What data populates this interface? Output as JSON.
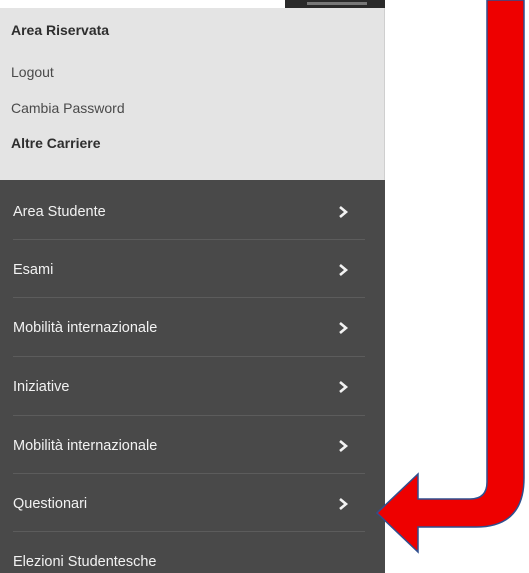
{
  "reserved_area": {
    "title": "Area Riservata",
    "logout": "Logout",
    "change_password": "Cambia Password",
    "other_careers": "Altre Carriere"
  },
  "menu": {
    "items": [
      {
        "label": "Area Studente"
      },
      {
        "label": "Esami"
      },
      {
        "label": "Mobilità internazionale"
      },
      {
        "label": "Iniziative"
      },
      {
        "label": "Mobilità internazionale"
      },
      {
        "label": "Questionari"
      },
      {
        "label": "Elezioni Studentesche"
      }
    ]
  },
  "colors": {
    "menu_background": "#494949",
    "reserved_area_background": "#e4e4e4",
    "arrow_fill": "#ee0000",
    "arrow_outline": "#2f4f8f"
  },
  "icons": {
    "chevron": "chevron-right-icon",
    "annotation": "red-arrow-pointer"
  }
}
